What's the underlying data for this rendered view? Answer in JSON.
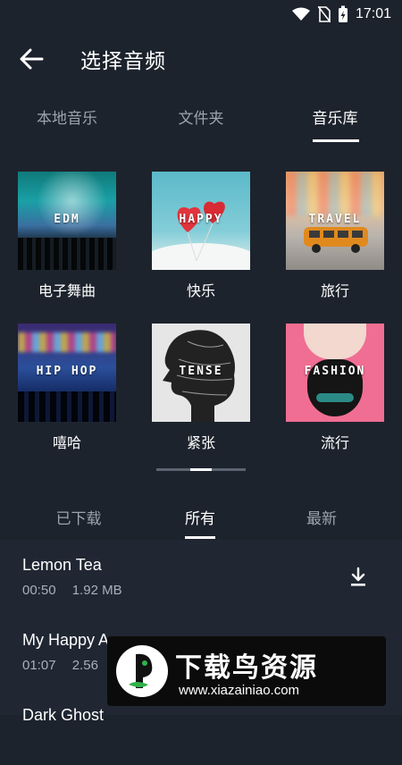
{
  "status_bar": {
    "time": "17:01",
    "icons": [
      "wifi-icon",
      "no-sim-icon",
      "battery-charging-icon"
    ]
  },
  "header": {
    "title": "选择音频",
    "back_icon": "arrow-left-icon"
  },
  "main_tabs": [
    {
      "label": "本地音乐",
      "active": false
    },
    {
      "label": "文件夹",
      "active": false
    },
    {
      "label": "音乐库",
      "active": true
    }
  ],
  "categories": [
    {
      "tag": "EDM",
      "label": "电子舞曲"
    },
    {
      "tag": "HAPPY",
      "label": "快乐"
    },
    {
      "tag": "TRAVEL",
      "label": "旅行"
    },
    {
      "tag": "HIP HOP",
      "label": "嘻哈"
    },
    {
      "tag": "TENSE",
      "label": "紧张"
    },
    {
      "tag": "FASHION",
      "label": "流行"
    }
  ],
  "sub_tabs": [
    {
      "label": "已下载",
      "active": false
    },
    {
      "label": "所有",
      "active": true
    },
    {
      "label": "最新",
      "active": false
    }
  ],
  "songs": [
    {
      "title": "Lemon Tea",
      "duration": "00:50",
      "size": "1.92 MB"
    },
    {
      "title": "My Happy A",
      "duration": "01:07",
      "size": "2.56"
    },
    {
      "title": "Dark Ghost",
      "duration": "",
      "size": ""
    }
  ],
  "watermark": {
    "title": "下载鸟资源",
    "url": "www.xiazainiao.com"
  },
  "colors": {
    "background": "#1d232d",
    "list_background": "#202733",
    "inactive_text": "#9aa3ae"
  }
}
